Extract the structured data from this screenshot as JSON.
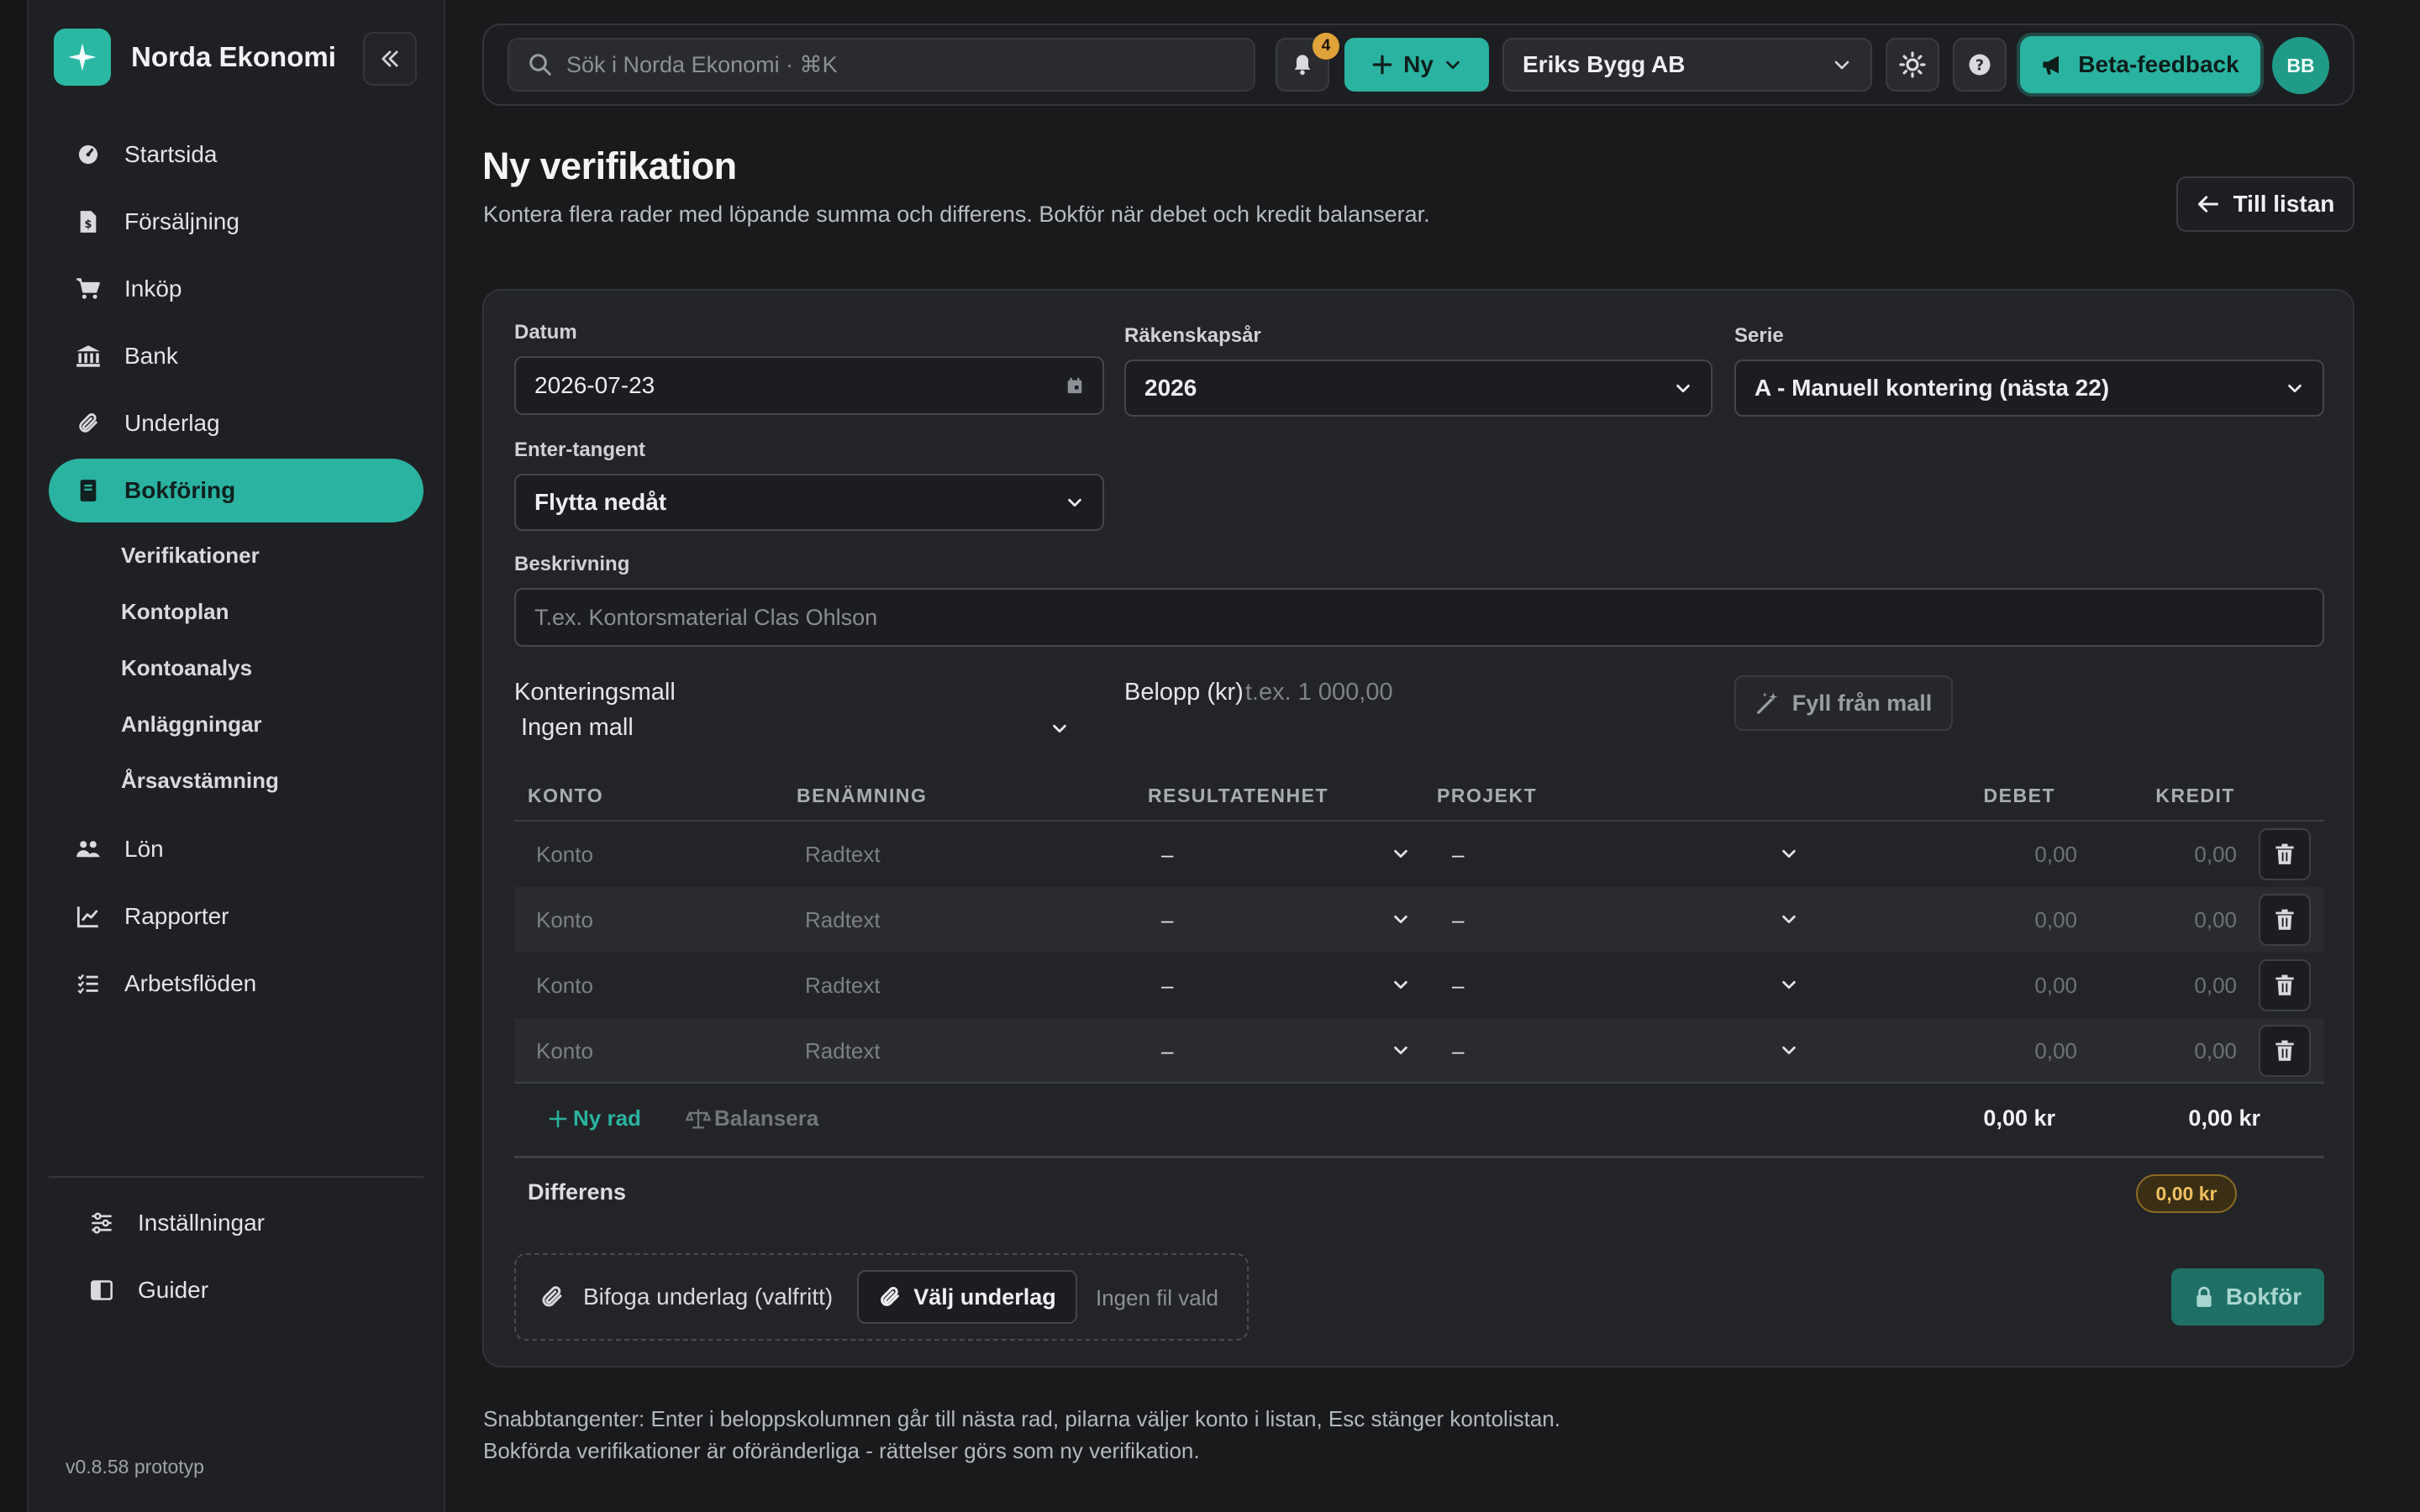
{
  "sidebar": {
    "brand": "Norda Ekonomi",
    "items": [
      {
        "label": "Startsida",
        "icon": "dashboard-icon"
      },
      {
        "label": "Försäljning",
        "icon": "invoice-icon"
      },
      {
        "label": "Inköp",
        "icon": "cart-icon"
      },
      {
        "label": "Bank",
        "icon": "bank-icon"
      },
      {
        "label": "Underlag",
        "icon": "paperclip-icon"
      },
      {
        "label": "Bokföring",
        "icon": "book-icon",
        "active": true
      }
    ],
    "subitems": [
      "Verifikationer",
      "Kontoplan",
      "Kontoanalys",
      "Anläggningar",
      "Årsavstämning"
    ],
    "items2": [
      {
        "label": "Lön",
        "icon": "people-icon"
      },
      {
        "label": "Rapporter",
        "icon": "chart-icon"
      },
      {
        "label": "Arbetsflöden",
        "icon": "checklist-icon"
      }
    ],
    "bottom": [
      {
        "label": "Inställningar",
        "icon": "sliders-icon"
      },
      {
        "label": "Guider",
        "icon": "guide-book-icon"
      }
    ],
    "version": "v0.8.58 prototyp"
  },
  "topbar": {
    "search_placeholder": "Sök i Norda Ekonomi · ⌘K",
    "notification_count": "4",
    "new_label": "Ny",
    "company": "Eriks Bygg AB",
    "feedback_label": "Beta-feedback",
    "avatar_initials": "BB"
  },
  "page": {
    "title": "Ny verifikation",
    "subtitle": "Kontera flera rader med löpande summa och differens. Bokför när debet och kredit balanserar.",
    "back_label": "Till listan"
  },
  "form": {
    "date_label": "Datum",
    "date_value": "2026-07-23",
    "fiscal_label": "Räkenskapsår",
    "fiscal_value": "2026",
    "series_label": "Serie",
    "series_value": "A - Manuell kontering (nästa 22)",
    "enter_label": "Enter-tangent",
    "enter_value": "Flytta nedåt",
    "description_label": "Beskrivning",
    "description_placeholder": "T.ex. Kontorsmaterial Clas Ohlson",
    "template_label": "Konteringsmall",
    "template_value": "Ingen mall",
    "amount_label": "Belopp (kr)",
    "amount_placeholder": "t.ex. 1 000,00",
    "fill_label": "Fyll från mall"
  },
  "table": {
    "headers": {
      "konto": "KONTO",
      "benamning": "BENÄMNING",
      "resultatenhet": "RESULTATENHET",
      "projekt": "PROJEKT",
      "debet": "DEBET",
      "kredit": "KREDIT"
    },
    "rows": [
      {
        "konto": "Konto",
        "text": "Radtext",
        "unit": "–",
        "project": "–",
        "debet": "0,00",
        "kredit": "0,00"
      },
      {
        "konto": "Konto",
        "text": "Radtext",
        "unit": "–",
        "project": "–",
        "debet": "0,00",
        "kredit": "0,00"
      },
      {
        "konto": "Konto",
        "text": "Radtext",
        "unit": "–",
        "project": "–",
        "debet": "0,00",
        "kredit": "0,00"
      },
      {
        "konto": "Konto",
        "text": "Radtext",
        "unit": "–",
        "project": "–",
        "debet": "0,00",
        "kredit": "0,00"
      }
    ],
    "add_row_label": "Ny rad",
    "balance_label": "Balansera",
    "total_debet": "0,00 kr",
    "total_kredit": "0,00 kr",
    "diff_label": "Differens",
    "diff_value": "0,00 kr"
  },
  "attachment": {
    "label": "Bifoga underlag (valfritt)",
    "choose_label": "Välj underlag",
    "no_file": "Ingen fil vald"
  },
  "post_label": "Bokför",
  "hints": {
    "line1": "Snabbtangenter: Enter i beloppskolumnen går till nästa rad, pilarna väljer konto i listan, Esc stänger kontolistan.",
    "line2": "Bokförda verifikationer är oföränderliga - rättelser görs som ny verifikation."
  },
  "colors": {
    "accent": "#2ab3a0",
    "background": "#191a1c",
    "surface": "#232427",
    "badge": "#e0a33a"
  }
}
